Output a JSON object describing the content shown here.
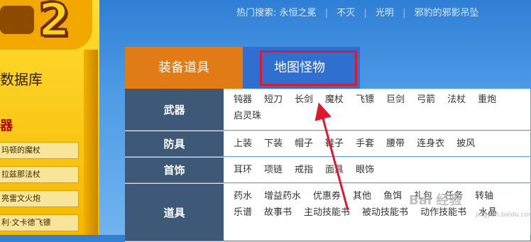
{
  "hot_search": {
    "label": "热门搜索:",
    "items": [
      "永恒之冕",
      "不灭",
      "光明",
      "邪豹的邪影吊坠"
    ]
  },
  "sidebar": {
    "db_title": "数据库",
    "category": "器",
    "items": [
      "玛顿的魔杖",
      "拉兹那法杖",
      "亮雷文火炮",
      "利·文卡德飞镖"
    ]
  },
  "tabs": {
    "equip": "装备道具",
    "map": "地图怪物"
  },
  "rows": [
    {
      "label": "武器",
      "items": [
        "钝器",
        "短刀",
        "长剑",
        "魔杖",
        "飞镖",
        "巨剑",
        "弓箭",
        "法杖",
        "重炮",
        "启灵珠"
      ]
    },
    {
      "label": "防具",
      "items": [
        "上装",
        "下装",
        "帽子",
        "鞋子",
        "手套",
        "腰带",
        "连身衣",
        "披风"
      ]
    },
    {
      "label": "首饰",
      "items": [
        "耳环",
        "项链",
        "戒指",
        "面具",
        "眼饰"
      ]
    },
    {
      "label": "道具",
      "items": [
        "药水",
        "增益药水",
        "优惠券",
        "其他",
        "鱼饵",
        "礼包",
        "任务",
        "转轴",
        "乐谱",
        "故事书",
        "主动技能书",
        "被动技能书",
        "动作技能书",
        "水晶"
      ]
    }
  ],
  "watermark": {
    "text": "Bai 经验",
    "sub": "jingyan.baidu.com"
  },
  "colors": {
    "tab_equip": "#e07b15",
    "tab_map": "#2f6fd0",
    "row_label": "#3e5878",
    "highlight": "#e0182d"
  }
}
